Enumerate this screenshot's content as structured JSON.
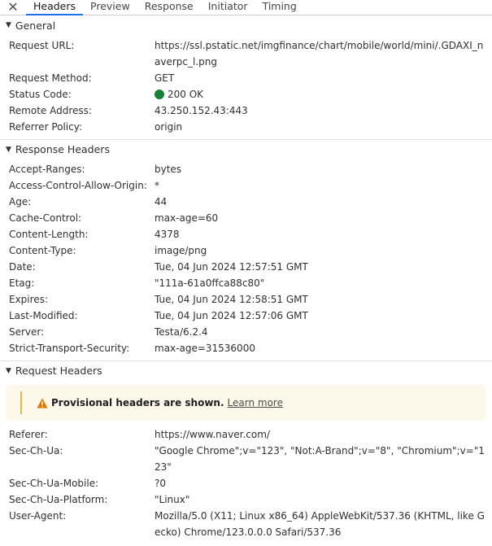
{
  "tabs": [
    "Headers",
    "Preview",
    "Response",
    "Initiator",
    "Timing"
  ],
  "close_glyph": "✕",
  "general": {
    "title": "General",
    "rows": [
      {
        "k": "Request URL:",
        "v": "https://ssl.pstatic.net/imgfinance/chart/mobile/world/mini/.GDAXI_naverpc_l.png"
      },
      {
        "k": "Request Method:",
        "v": "GET"
      },
      {
        "k": "Status Code:",
        "v": "200 OK"
      },
      {
        "k": "Remote Address:",
        "v": "43.250.152.43:443"
      },
      {
        "k": "Referrer Policy:",
        "v": "origin"
      }
    ]
  },
  "response_headers": {
    "title": "Response Headers",
    "rows": [
      {
        "k": "Accept-Ranges:",
        "v": "bytes"
      },
      {
        "k": "Access-Control-Allow-Origin:",
        "v": "*"
      },
      {
        "k": "Age:",
        "v": "44"
      },
      {
        "k": "Cache-Control:",
        "v": "max-age=60"
      },
      {
        "k": "Content-Length:",
        "v": "4378"
      },
      {
        "k": "Content-Type:",
        "v": "image/png"
      },
      {
        "k": "Date:",
        "v": "Tue, 04 Jun 2024 12:57:51 GMT"
      },
      {
        "k": "Etag:",
        "v": "\"111a-61a0ffca88c80\""
      },
      {
        "k": "Expires:",
        "v": "Tue, 04 Jun 2024 12:58:51 GMT"
      },
      {
        "k": "Last-Modified:",
        "v": "Tue, 04 Jun 2024 12:57:06 GMT"
      },
      {
        "k": "Server:",
        "v": "Testa/6.2.4"
      },
      {
        "k": "Strict-Transport-Security:",
        "v": "max-age=31536000"
      }
    ]
  },
  "request_headers": {
    "title": "Request Headers",
    "banner_text": "Provisional headers are shown.",
    "banner_link": "Learn more",
    "rows": [
      {
        "k": "Referer:",
        "v": "https://www.naver.com/"
      },
      {
        "k": "Sec-Ch-Ua:",
        "v": "\"Google Chrome\";v=\"123\", \"Not:A-Brand\";v=\"8\", \"Chromium\";v=\"123\""
      },
      {
        "k": "Sec-Ch-Ua-Mobile:",
        "v": "?0"
      },
      {
        "k": "Sec-Ch-Ua-Platform:",
        "v": "\"Linux\""
      },
      {
        "k": "User-Agent:",
        "v": "Mozilla/5.0 (X11; Linux x86_64) AppleWebKit/537.36 (KHTML, like Gecko) Chrome/123.0.0.0 Safari/537.36"
      }
    ]
  },
  "colors": {
    "accent": "#1a73e8",
    "status_ok": "#188038",
    "warning": "#e37400"
  }
}
